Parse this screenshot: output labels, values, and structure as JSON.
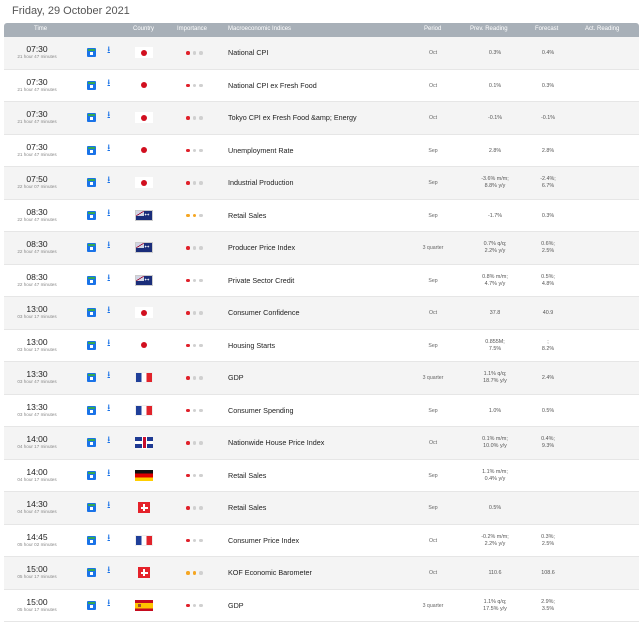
{
  "date_title": "Friday, 29 October 2021",
  "headers": [
    "Time",
    "Country",
    "Importance",
    "Macroeconomic Indices",
    "Period",
    "Prev. Reading",
    "Forecast",
    "Act. Reading"
  ],
  "colors": {
    "header_bg": "#a8b0b8",
    "high": "#e0202a",
    "medium": "#f5a623",
    "low": "#d0d0d0",
    "link": "#1a73e8"
  },
  "rows": [
    {
      "time": "07:30",
      "elapsed": "21 hour 47 minutes",
      "flag": "jp",
      "importance": 1,
      "name": "National CPI",
      "period": "Oct",
      "prev1": "0.3%",
      "prev2": "",
      "fc1": "0.4%",
      "fc2": ""
    },
    {
      "time": "07:30",
      "elapsed": "21 hour 47 minutes",
      "flag": "jp",
      "importance": 1,
      "name": "National CPI ex Fresh Food",
      "period": "Oct",
      "prev1": "0.1%",
      "prev2": "",
      "fc1": "0.3%",
      "fc2": ""
    },
    {
      "time": "07:30",
      "elapsed": "21 hour 47 minutes",
      "flag": "jp",
      "importance": 1,
      "name": "Tokyo CPI ex Fresh Food &amp; Energy",
      "period": "Oct",
      "prev1": "-0.1%",
      "prev2": "",
      "fc1": "-0.1%",
      "fc2": ""
    },
    {
      "time": "07:30",
      "elapsed": "21 hour 47 minutes",
      "flag": "jp",
      "importance": 1,
      "name": "Unemployment Rate",
      "period": "Sep",
      "prev1": "2.8%",
      "prev2": "",
      "fc1": "2.8%",
      "fc2": ""
    },
    {
      "time": "07:50",
      "elapsed": "22 hour 07 minutes",
      "flag": "jp",
      "importance": 1,
      "name": "Industrial Production",
      "period": "Sep",
      "prev1": "-3.6% m/m;",
      "prev2": "8.8% y/y",
      "fc1": "-2.4%;",
      "fc2": "6.7%"
    },
    {
      "time": "08:30",
      "elapsed": "22 hour 47 minutes",
      "flag": "au",
      "importance": 2,
      "name": "Retail Sales",
      "period": "Sep",
      "prev1": "-1.7%",
      "prev2": "",
      "fc1": "0.3%",
      "fc2": ""
    },
    {
      "time": "08:30",
      "elapsed": "22 hour 47 minutes",
      "flag": "au",
      "importance": 1,
      "name": "Producer Price Index",
      "period": "3 quarter",
      "prev1": "0.7% q/q;",
      "prev2": "2.2% y/y",
      "fc1": "0.6%;",
      "fc2": "2.5%"
    },
    {
      "time": "08:30",
      "elapsed": "22 hour 47 minutes",
      "flag": "au",
      "importance": 1,
      "name": "Private Sector Credit",
      "period": "Sep",
      "prev1": "0.8% m/m;",
      "prev2": "4.7% y/y",
      "fc1": "0.5%;",
      "fc2": "4.8%"
    },
    {
      "time": "13:00",
      "elapsed": "03 hour 17 minutes",
      "flag": "jp",
      "importance": 1,
      "name": "Consumer Confidence",
      "period": "Oct",
      "prev1": "37.8",
      "prev2": "",
      "fc1": "40.9",
      "fc2": ""
    },
    {
      "time": "13:00",
      "elapsed": "03 hour 17 minutes",
      "flag": "jp",
      "importance": 1,
      "name": "Housing Starts",
      "period": "Sep",
      "prev1": "0.855M;",
      "prev2": "7.5%",
      "fc1": ";",
      "fc2": "8.2%"
    },
    {
      "time": "13:30",
      "elapsed": "03 hour 47 minutes",
      "flag": "fr",
      "importance": 1,
      "name": "GDP",
      "period": "3 quarter",
      "prev1": "1.1% q/q;",
      "prev2": "18.7% y/y",
      "fc1": "2.4%",
      "fc2": ""
    },
    {
      "time": "13:30",
      "elapsed": "03 hour 47 minutes",
      "flag": "fr",
      "importance": 1,
      "name": "Consumer Spending",
      "period": "Sep",
      "prev1": "1.0%",
      "prev2": "",
      "fc1": "0.5%",
      "fc2": ""
    },
    {
      "time": "14:00",
      "elapsed": "04 hour 17 minutes",
      "flag": "gb",
      "importance": 1,
      "name": "Nationwide House Price Index",
      "period": "Oct",
      "prev1": "0.1% m/m;",
      "prev2": "10.0% y/y",
      "fc1": "0.4%;",
      "fc2": "9.3%"
    },
    {
      "time": "14:00",
      "elapsed": "04 hour 17 minutes",
      "flag": "de",
      "importance": 1,
      "name": "Retail Sales",
      "period": "Sep",
      "prev1": "1.1% m/m;",
      "prev2": "0.4% y/y",
      "fc1": "",
      "fc2": ""
    },
    {
      "time": "14:30",
      "elapsed": "04 hour 47 minutes",
      "flag": "ch",
      "importance": 1,
      "name": "Retail Sales",
      "period": "Sep",
      "prev1": "0.5%",
      "prev2": "",
      "fc1": "",
      "fc2": ""
    },
    {
      "time": "14:45",
      "elapsed": "05 hour 02 minutes",
      "flag": "fr",
      "importance": 1,
      "name": "Consumer Price Index",
      "period": "Oct",
      "prev1": "-0.2% m/m;",
      "prev2": "2.2% y/y",
      "fc1": "0.3%;",
      "fc2": "2.5%"
    },
    {
      "time": "15:00",
      "elapsed": "05 hour 17 minutes",
      "flag": "ch",
      "importance": 2,
      "name": "KOF Economic Barometer",
      "period": "Oct",
      "prev1": "110.6",
      "prev2": "",
      "fc1": "108.6",
      "fc2": ""
    },
    {
      "time": "15:00",
      "elapsed": "05 hour 17 minutes",
      "flag": "es",
      "importance": 1,
      "name": "GDP",
      "period": "3 quarter",
      "prev1": "1.1% q/q;",
      "prev2": "17.5% y/y",
      "fc1": "2.9%;",
      "fc2": "3.5%"
    }
  ]
}
